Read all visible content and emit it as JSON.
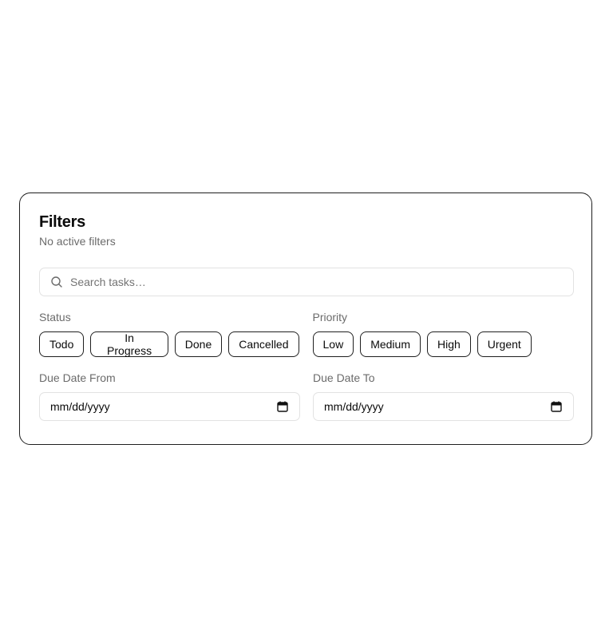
{
  "filters": {
    "title": "Filters",
    "subtitle": "No active filters",
    "search": {
      "placeholder": "Search tasks…",
      "value": ""
    },
    "status": {
      "label": "Status",
      "options": [
        "Todo",
        "In Progress",
        "Done",
        "Cancelled"
      ]
    },
    "priority": {
      "label": "Priority",
      "options": [
        "Low",
        "Medium",
        "High",
        "Urgent"
      ]
    },
    "due_from": {
      "label": "Due Date From",
      "placeholder": "mm/dd/yyyy"
    },
    "due_to": {
      "label": "Due Date To",
      "placeholder": "mm/dd/yyyy"
    }
  },
  "colors": {
    "border": "#1f1f1f",
    "input_border": "#e2e2e2",
    "muted_text": "#6b6b6b"
  },
  "icons": {
    "search": "search-icon",
    "calendar": "calendar-icon"
  }
}
